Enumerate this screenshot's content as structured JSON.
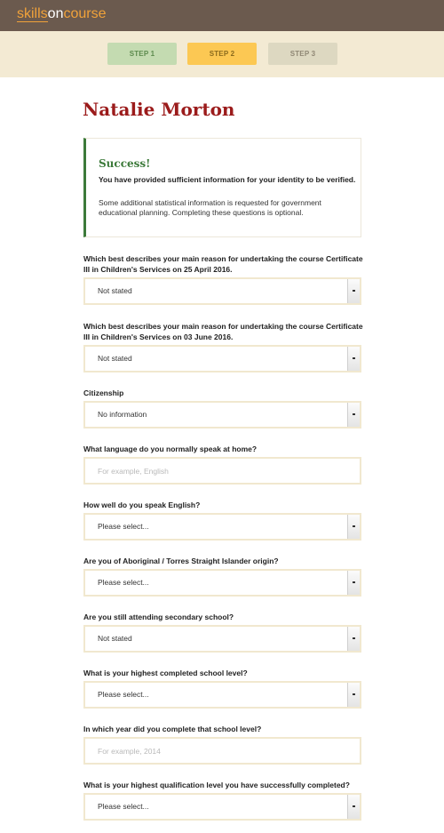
{
  "header": {
    "logo_part1": "skills",
    "logo_part2": "on",
    "logo_part3": "course"
  },
  "steps": [
    {
      "label": "STEP 1"
    },
    {
      "label": "STEP 2"
    },
    {
      "label": "STEP 3"
    }
  ],
  "user_name": "Natalie Morton",
  "alert": {
    "title": "Success!",
    "strong": "You have provided sufficient information for your identity to be verified.",
    "text": "Some additional statistical information is requested for government educational planning. Completing these questions is optional."
  },
  "fields": [
    {
      "label": "Which best describes your main reason for undertaking the course Certificate III in Children's Services on 25 April 2016.",
      "value": "Not stated"
    },
    {
      "label": "Which best describes your main reason for undertaking the course Certificate III in Children's Services on 03 June 2016.",
      "value": "Not stated"
    },
    {
      "label": "Citizenship",
      "value": "No information"
    },
    {
      "label": "What language do you normally speak at home?",
      "placeholder": "For example, English"
    },
    {
      "label": "How well do you speak English?",
      "value": "Please select..."
    },
    {
      "label": "Are you of Aboriginal / Torres Straight Islander origin?",
      "value": "Please select..."
    },
    {
      "label": "Are you still attending secondary school?",
      "value": "Not stated"
    },
    {
      "label": "What is your highest completed school level?",
      "value": "Please select..."
    },
    {
      "label": "In which year did you complete that school level?",
      "placeholder": "For example, 2014"
    },
    {
      "label": "What is your highest qualification level you have successfully completed?",
      "value": "Please select..."
    }
  ]
}
